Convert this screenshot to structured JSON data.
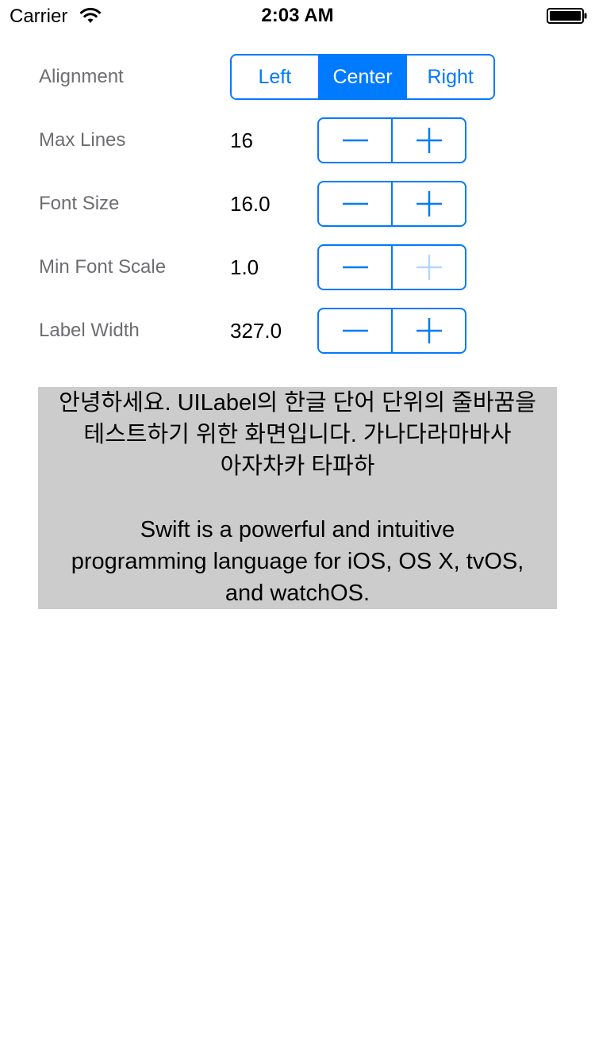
{
  "status_bar": {
    "carrier": "Carrier",
    "time": "2:03 AM",
    "wifi_icon": "wifi-icon",
    "battery_icon": "battery-full-icon"
  },
  "alignment": {
    "label": "Alignment",
    "segments": [
      "Left",
      "Center",
      "Right"
    ],
    "selected": "Center"
  },
  "rows": [
    {
      "label": "Max Lines",
      "value": "16",
      "minus_enabled": true,
      "plus_enabled": true
    },
    {
      "label": "Font Size",
      "value": "16.0",
      "minus_enabled": true,
      "plus_enabled": true
    },
    {
      "label": "Min Font Scale",
      "value": "1.0",
      "minus_enabled": true,
      "plus_enabled": false
    },
    {
      "label": "Label Width",
      "value": "327.0",
      "minus_enabled": true,
      "plus_enabled": true
    }
  ],
  "demo_text": {
    "lines": [
      "안녕하세요. UILabel의 한글 단어 단위의 줄바꿈을",
      "테스트하기 위한 화면입니다. 가나다라마바사",
      "아자차카 타파하",
      "",
      "Swift is a powerful and intuitive",
      "programming language for iOS, OS X, tvOS,",
      "and watchOS."
    ]
  },
  "colors": {
    "accent": "#007aff",
    "accent_disabled": "#b3d7ff",
    "label_gray": "#6d6d72",
    "demo_background": "#cccccc"
  }
}
